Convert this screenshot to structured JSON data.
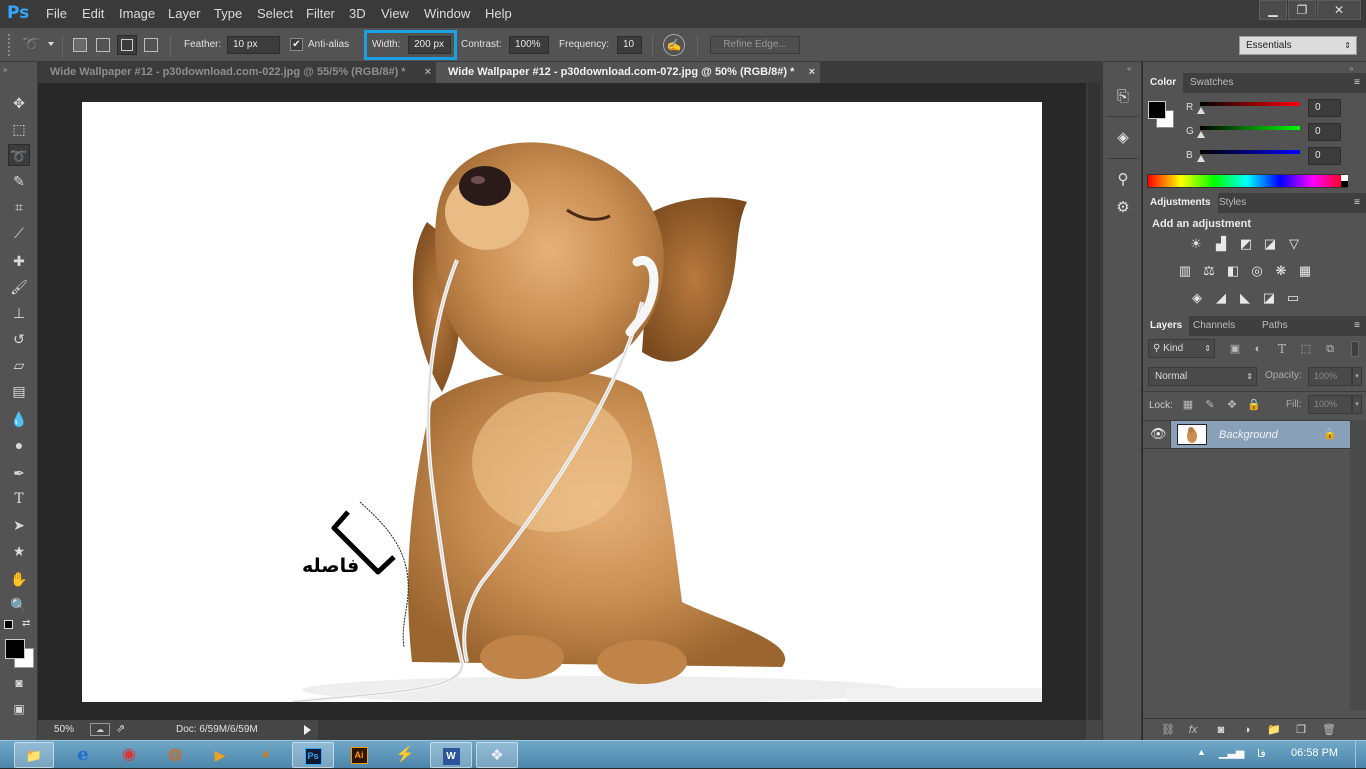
{
  "app": {
    "logo": "Ps"
  },
  "menu": [
    "File",
    "Edit",
    "Image",
    "Layer",
    "Type",
    "Select",
    "Filter",
    "3D",
    "View",
    "Window",
    "Help"
  ],
  "window_controls": {
    "minimize": "▁",
    "restore": "❐",
    "close": "✕"
  },
  "options": {
    "feather_label": "Feather:",
    "feather_value": "10 px",
    "antialias_label": "Anti-alias",
    "width_label": "Width:",
    "width_value": "200 px",
    "contrast_label": "Contrast:",
    "contrast_value": "100%",
    "frequency_label": "Frequency:",
    "frequency_value": "10",
    "refine_edge": "Refine Edge...",
    "workspace": "Essentials",
    "highlight_color": "#1ba1e2"
  },
  "tabs": [
    {
      "label": "Wide Wallpaper #12 - p30download.com-022.jpg @ 55/5% (RGB/8#) *",
      "close": "×"
    },
    {
      "label": "Wide Wallpaper #12 - p30download.com-072.jpg @ 50% (RGB/8#) *",
      "close": "×"
    }
  ],
  "tools": [
    {
      "name": "move-tool-icon",
      "glyph": "✥"
    },
    {
      "name": "marquee-tool-icon",
      "glyph": "⬚"
    },
    {
      "name": "magnetic-lasso-tool-icon",
      "glyph": "➰"
    },
    {
      "name": "quick-selection-tool-icon",
      "glyph": "✎"
    },
    {
      "name": "crop-tool-icon",
      "glyph": "⌗"
    },
    {
      "name": "eyedropper-tool-icon",
      "glyph": "⟋"
    },
    {
      "name": "healing-brush-tool-icon",
      "glyph": "✚"
    },
    {
      "name": "brush-tool-icon",
      "glyph": "🖌"
    },
    {
      "name": "clone-stamp-tool-icon",
      "glyph": "⊥"
    },
    {
      "name": "history-brush-tool-icon",
      "glyph": "↺"
    },
    {
      "name": "eraser-tool-icon",
      "glyph": "▱"
    },
    {
      "name": "gradient-tool-icon",
      "glyph": "▤"
    },
    {
      "name": "blur-tool-icon",
      "glyph": "💧"
    },
    {
      "name": "dodge-tool-icon",
      "glyph": "●"
    },
    {
      "name": "pen-tool-icon",
      "glyph": "✒"
    },
    {
      "name": "type-tool-icon",
      "glyph": "T"
    },
    {
      "name": "path-selection-tool-icon",
      "glyph": "➤"
    },
    {
      "name": "shape-tool-icon",
      "glyph": "★"
    },
    {
      "name": "hand-tool-icon",
      "glyph": "✋"
    },
    {
      "name": "zoom-tool-icon",
      "glyph": "🔍"
    }
  ],
  "canvas": {
    "annotation": "فاصله"
  },
  "status": {
    "zoom": "50%",
    "doc": "Doc: 6/59M/6/59M"
  },
  "color_panel": {
    "tabs": [
      "Color",
      "Swatches"
    ],
    "r_label": "R",
    "g_label": "G",
    "b_label": "B",
    "r_value": "0",
    "g_value": "0",
    "b_value": "0"
  },
  "adjustments_panel": {
    "tabs": [
      "Adjustments",
      "Styles"
    ],
    "heading": "Add an adjustment",
    "icons": [
      [
        "brightness-icon",
        "levels-icon",
        "curves-icon",
        "exposure-icon",
        "gradient-map-triangle-icon"
      ],
      [
        "vibrance-icon",
        "color-balance-icon",
        "black-white-icon",
        "photo-filter-icon",
        "channel-mixer-icon",
        "color-lookup-icon"
      ],
      [
        "invert-icon",
        "posterize-icon",
        "threshold-icon",
        "selective-color-icon",
        "gradient-map-icon"
      ]
    ],
    "glyphs": [
      [
        "☀",
        "▟",
        "◩",
        "◪",
        "▽"
      ],
      [
        "▥",
        "⚖",
        "◧",
        "◎",
        "❋",
        "▦"
      ],
      [
        "◈",
        "◢",
        "◣",
        "◪",
        "▭"
      ]
    ]
  },
  "layers_panel": {
    "tabs": [
      "Layers",
      "Channels",
      "Paths"
    ],
    "kind": "Kind",
    "blend_mode": "Normal",
    "opacity_label": "Opacity:",
    "opacity_value": "100%",
    "lock_label": "Lock:",
    "fill_label": "Fill:",
    "fill_value": "100%",
    "layer_name": "Background"
  },
  "taskbar": {
    "apps": [
      {
        "name": "explorer-taskbar-icon",
        "glyph": "📁"
      },
      {
        "name": "ie-taskbar-icon",
        "glyph": "e"
      },
      {
        "name": "chrome-taskbar-icon",
        "glyph": "◉"
      },
      {
        "name": "firefox-taskbar-icon",
        "glyph": "◍"
      },
      {
        "name": "media-player-taskbar-icon",
        "glyph": "▶"
      },
      {
        "name": "blender-taskbar-icon",
        "glyph": "◐"
      },
      {
        "name": "photoshop-taskbar-icon",
        "glyph": "Ps"
      },
      {
        "name": "illustrator-taskbar-icon",
        "glyph": "Ai"
      },
      {
        "name": "kmplayer-taskbar-icon",
        "glyph": "⚡"
      },
      {
        "name": "word-taskbar-icon",
        "glyph": "W"
      },
      {
        "name": "app-taskbar-icon",
        "glyph": "❖"
      }
    ],
    "lang": "فا",
    "time": "06:58 PM"
  }
}
